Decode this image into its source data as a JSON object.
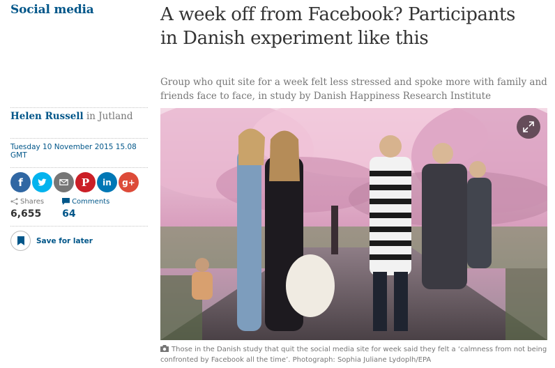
{
  "section": {
    "label": "Social media"
  },
  "article": {
    "headline_line1": "A week off from Facebook? Participants",
    "headline_line2": "in Danish experiment like this",
    "standfirst_line1": "Group who quit site for a week felt less stressed and spoke more with family and",
    "standfirst_line2": "friends face to face, in study by Danish Happiness Research Institute"
  },
  "byline": {
    "author": "Helen Russell",
    "location": " in Jutland"
  },
  "dateline": "Tuesday 10 November 2015 15.08 GMT",
  "share_buttons": [
    {
      "name": "facebook-share-button",
      "icon": "facebook-icon",
      "glyph": "f",
      "color": "#3067a3"
    },
    {
      "name": "twitter-share-button",
      "icon": "twitter-icon",
      "glyph": "",
      "color": "#03b3ee"
    },
    {
      "name": "email-share-button",
      "icon": "email-icon",
      "glyph": "",
      "color": "#767676"
    },
    {
      "name": "pinterest-share-button",
      "icon": "pinterest-icon",
      "glyph": "P",
      "color": "#cb1f27"
    },
    {
      "name": "linkedin-share-button",
      "icon": "linkedin-icon",
      "glyph": "in",
      "color": "#0077b5"
    },
    {
      "name": "googleplus-share-button",
      "icon": "google-plus-icon",
      "glyph": "g+",
      "color": "#dd4b39"
    }
  ],
  "counts": {
    "shares_label": "Shares",
    "shares_value": "6,655",
    "comments_label": "Comments",
    "comments_value": "64"
  },
  "save": {
    "label": "Save for later"
  },
  "photo": {
    "caption_line1": "Those in the Danish study that quit the social media site for week said they felt a ‘calmness from not being",
    "caption_line2": "confronted by Facebook all the time’. Photograph: Sophia Juliane Lydoplh/EPA",
    "expand_icon": "expand-icon",
    "camera_icon": "camera-icon"
  },
  "colors": {
    "brand_blue": "#005689",
    "muted": "#767676"
  }
}
